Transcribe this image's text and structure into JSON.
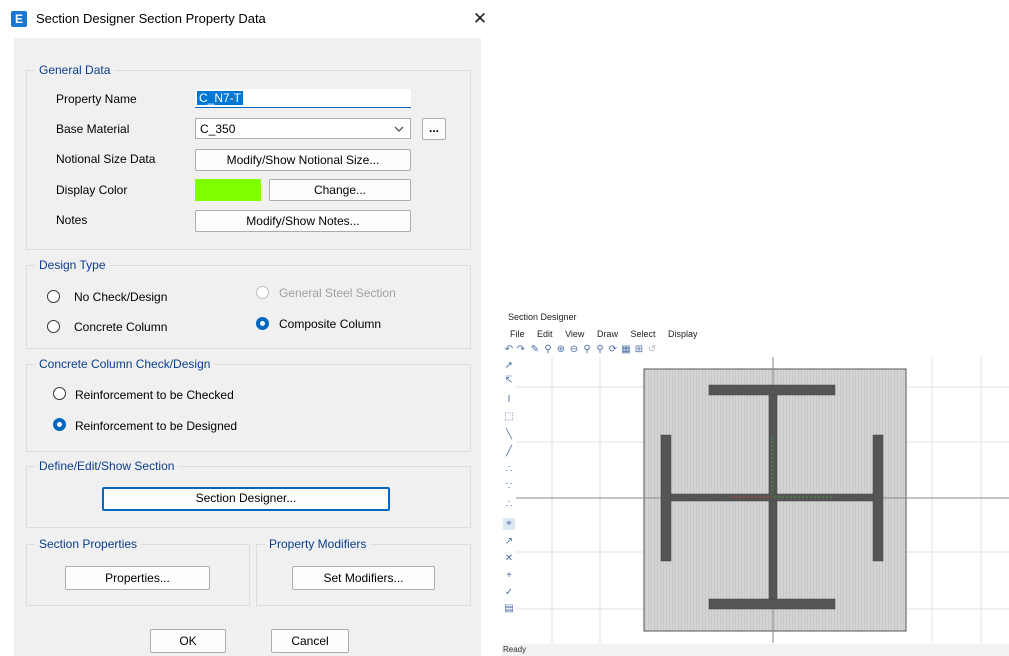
{
  "dialog": {
    "title": "Section Designer Section Property Data",
    "icon_letter": "E",
    "close_glyph": "✕",
    "general_data": {
      "group_title": "General Data",
      "property_name_label": "Property Name",
      "property_name_value": "C_N7-T",
      "base_material_label": "Base Material",
      "base_material_value": "C_350",
      "material_more_label": "...",
      "notional_label": "Notional Size Data",
      "notional_button": "Modify/Show Notional Size...",
      "display_color_label": "Display Color",
      "display_color": "#80ff00",
      "change_button": "Change...",
      "notes_label": "Notes",
      "notes_button": "Modify/Show Notes..."
    },
    "design_type": {
      "group_title": "Design Type",
      "no_check": "No Check/Design",
      "general_steel": "General Steel Section",
      "concrete_column": "Concrete Column",
      "composite_column": "Composite Column"
    },
    "concrete_check": {
      "group_title": "Concrete Column Check/Design",
      "checked": "Reinforcement to be Checked",
      "designed": "Reinforcement to be Designed"
    },
    "define_section": {
      "group_title": "Define/Edit/Show Section",
      "button": "Section Designer..."
    },
    "section_properties": {
      "group_title": "Section Properties",
      "button": "Properties..."
    },
    "property_modifiers": {
      "group_title": "Property Modifiers",
      "button": "Set Modifiers..."
    },
    "ok": "OK",
    "cancel": "Cancel"
  },
  "section_designer": {
    "title": "Section Designer",
    "menu": [
      "File",
      "Edit",
      "View",
      "Draw",
      "Select",
      "Display"
    ],
    "status": "Ready",
    "section_fill": "#d4d4d4",
    "steel_color": "#555555"
  },
  "colors": {
    "accent": "#0067c0",
    "group_title": "#0b3d8c"
  }
}
